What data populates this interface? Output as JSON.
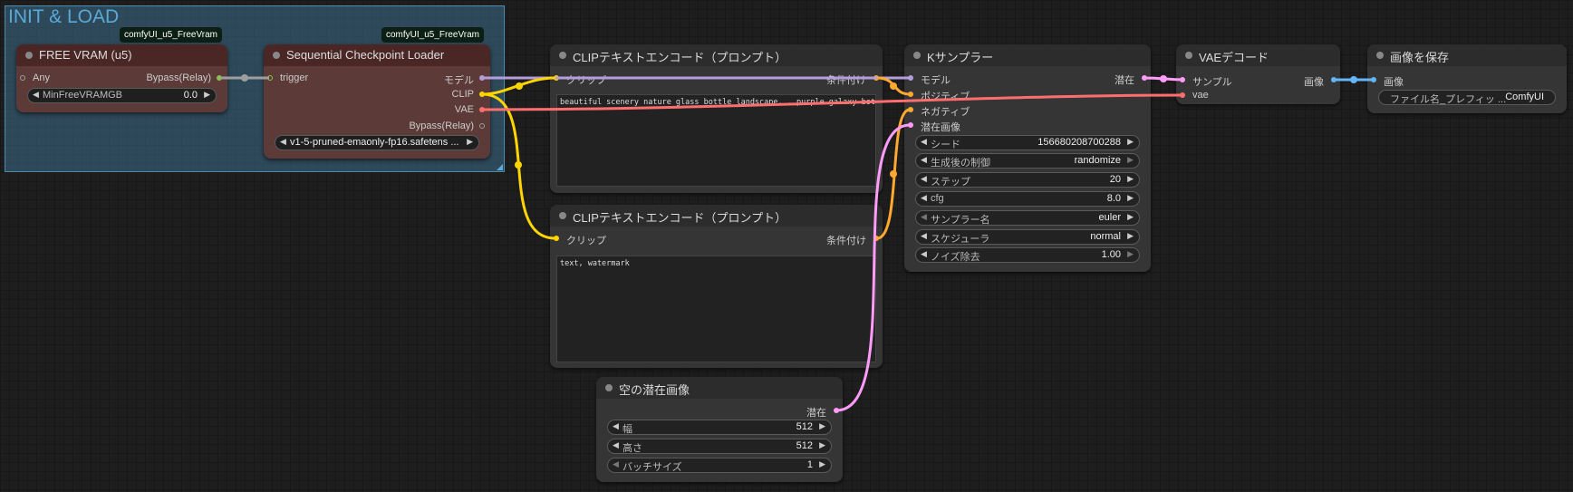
{
  "colors": {
    "model": "#b39ddb",
    "clip": "#ffd500",
    "vae": "#ff6e6e",
    "conditioning": "#ffa931",
    "latent": "#ff9cf9",
    "image": "#64b5f6",
    "any": "#9e9e9e",
    "trigger": "#8bc34a"
  },
  "group": {
    "title": "INIT & LOAD"
  },
  "badges": {
    "free_vram": "comfyUI_u5_FreeVram",
    "checkpoint": "comfyUI_u5_FreeVram"
  },
  "nodes": {
    "free_vram": {
      "title": "FREE VRAM (u5)",
      "input": "Any",
      "output": "Bypass(Relay)",
      "widget": {
        "label": "MinFreeVRAMGB",
        "value": "0.0"
      }
    },
    "checkpoint": {
      "title": "Sequential Checkpoint Loader",
      "input": "trigger",
      "outputs": {
        "model": "モデル",
        "clip": "CLIP",
        "vae": "VAE",
        "bypass": "Bypass(Relay)"
      },
      "widget": {
        "value": "v1-5-pruned-emaonly-fp16.safetens ..."
      }
    },
    "clip_pos": {
      "title": "CLIPテキストエンコード（プロンプト）",
      "input": "クリップ",
      "output": "条件付け",
      "text": "beautiful scenery nature glass bottle landscape, , purple galaxy bottle,"
    },
    "clip_neg": {
      "title": "CLIPテキストエンコード（プロンプト）",
      "input": "クリップ",
      "output": "条件付け",
      "text": "text, watermark"
    },
    "ksampler": {
      "title": "Kサンプラー",
      "inputs": {
        "model": "モデル",
        "positive": "ポジティブ",
        "negative": "ネガティブ",
        "latent": "潜在画像"
      },
      "output": "潜在",
      "widgets": [
        {
          "label": "シード",
          "value": "156680208700288"
        },
        {
          "label": "生成後の制御",
          "value": "randomize"
        },
        {
          "label": "ステップ",
          "value": "20"
        },
        {
          "label": "cfg",
          "value": "8.0"
        },
        {
          "label": "サンプラー名",
          "value": "euler"
        },
        {
          "label": "スケジューラ",
          "value": "normal"
        },
        {
          "label": "ノイズ除去",
          "value": "1.00"
        }
      ]
    },
    "vae_decode": {
      "title": "VAEデコード",
      "inputs": {
        "samples": "サンプル",
        "vae": "vae"
      },
      "output": "画像"
    },
    "save_image": {
      "title": "画像を保存",
      "input": "画像",
      "widget": {
        "label": "ファイル名_プレフィッ ...",
        "value": "ComfyUI"
      }
    },
    "empty_latent": {
      "title": "空の潜在画像",
      "output": "潜在",
      "widgets": [
        {
          "label": "幅",
          "value": "512"
        },
        {
          "label": "高さ",
          "value": "512"
        },
        {
          "label": "バッチサイズ",
          "value": "1"
        }
      ]
    }
  },
  "icons": {
    "arrow_left": "◀",
    "arrow_right": "▶"
  }
}
